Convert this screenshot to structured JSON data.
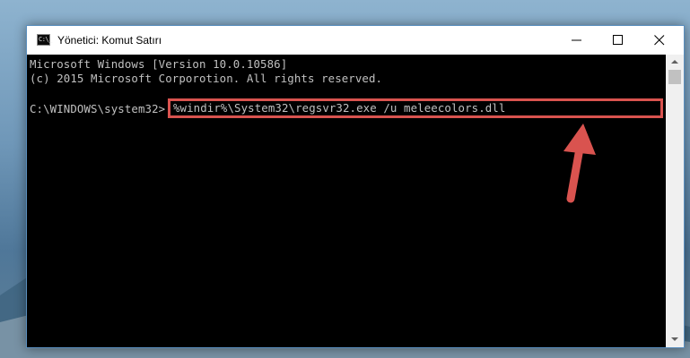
{
  "window": {
    "title": "Yönetici: Komut Satırı",
    "icon_label": "C:\\_"
  },
  "controls": {
    "minimize_icon": "minimize-icon",
    "maximize_icon": "maximize-icon",
    "close_icon": "close-icon"
  },
  "console": {
    "line1": "Microsoft Windows [Version 10.0.10586]",
    "line2": "(c) 2015 Microsoft Corporotion. All rights reserved.",
    "prompt": "C:\\WINDOWS\\system32>",
    "command": "%windir%\\System32\\regsvr32.exe /u meleecolors.dll"
  },
  "colors": {
    "console_bg": "#000000",
    "console_text": "#c0c0c0",
    "highlight": "#d9534f"
  }
}
